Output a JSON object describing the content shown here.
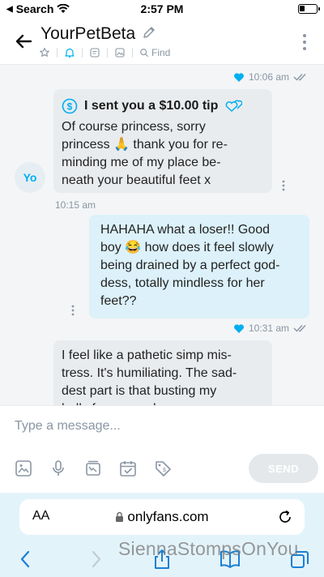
{
  "status_bar": {
    "back_label": "Search",
    "time": "2:57 PM"
  },
  "header": {
    "title": "YourPetBeta",
    "find_label": "Find"
  },
  "messages": [
    {
      "time": "10:06 am"
    },
    {
      "tip_text": "I sent you a $10.00 tip",
      "text": "Of course princess, sorry\nprincess 🙏 thank you for re-\nminding me of my place be-\nneath your beautiful feet x",
      "avatar": "Yo",
      "time": "10:15 am"
    },
    {
      "text": "HAHAHA what a loser!! Good\nboy 😂 how does it feel slowly\nbeing drained by a perfect god-\ndess, totally mindless for her\nfeet??",
      "time": "10:31 am"
    },
    {
      "text": "I feel like a pathetic simp mis-\ntress. It's humiliating. The sad-\ndest part is that busting my\nballs for you makes me..."
    }
  ],
  "composer": {
    "placeholder": "Type a message...",
    "send_label": "SEND"
  },
  "browser": {
    "aa_label": "AA",
    "url": "onlyfans.com"
  },
  "watermark": "SiennaStompsOnYou",
  "colors": {
    "accent": "#00aff0",
    "incoming": "#e9ecef",
    "outgoing": "#dcf1f9",
    "browser": "#e3f3fa"
  }
}
